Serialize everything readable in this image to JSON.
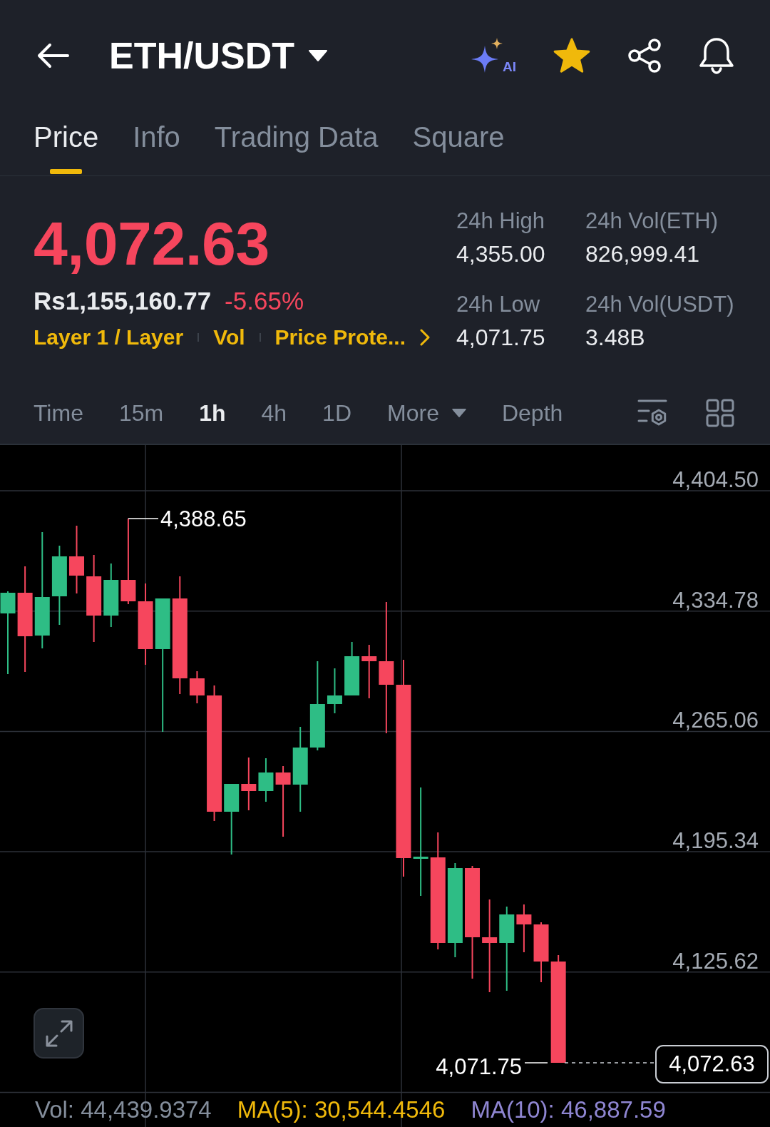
{
  "header": {
    "title": "ETH/USDT",
    "ai_badge": "AI",
    "favorite": true
  },
  "tabs": [
    {
      "label": "Price",
      "selected": true
    },
    {
      "label": "Info",
      "selected": false
    },
    {
      "label": "Trading Data",
      "selected": false
    },
    {
      "label": "Square",
      "selected": false
    }
  ],
  "ticker": {
    "last_price": "4,072.63",
    "falling": true,
    "fiat_price": "Rs1,155,160.77",
    "change": "-5.65%",
    "tags": [
      "Layer 1 / Layer",
      "Vol",
      "Price Prote..."
    ],
    "stats": [
      {
        "label": "24h High",
        "value": "4,355.00"
      },
      {
        "label": "24h Vol(ETH)",
        "value": "826,999.41"
      },
      {
        "label": "24h Low",
        "value": "4,071.75"
      },
      {
        "label": "24h Vol(USDT)",
        "value": "3.48B"
      }
    ]
  },
  "intervals": [
    {
      "label": "Time",
      "kind": "option",
      "selected": false
    },
    {
      "label": "15m",
      "kind": "option",
      "selected": false
    },
    {
      "label": "1h",
      "kind": "option",
      "selected": true
    },
    {
      "label": "4h",
      "kind": "option",
      "selected": false
    },
    {
      "label": "1D",
      "kind": "option",
      "selected": false
    },
    {
      "label": "More",
      "kind": "menu",
      "selected": false
    },
    {
      "label": "Depth",
      "kind": "option",
      "selected": false
    }
  ],
  "chart": {
    "price_axis": [
      "4,404.50",
      "4,334.78",
      "4,265.06",
      "4,195.34",
      "4,125.62"
    ],
    "high_label": "4,388.65",
    "low_label": "4,071.75",
    "price_tag": "4,072.63"
  },
  "indicators": [
    {
      "label": "Vol: 44,439.9374",
      "color": "#848e9c"
    },
    {
      "label": "MA(5): 30,544.4546",
      "color": "#f0b90b"
    },
    {
      "label": "MA(10): 46,887.59",
      "color": "#8f86d2"
    }
  ]
}
